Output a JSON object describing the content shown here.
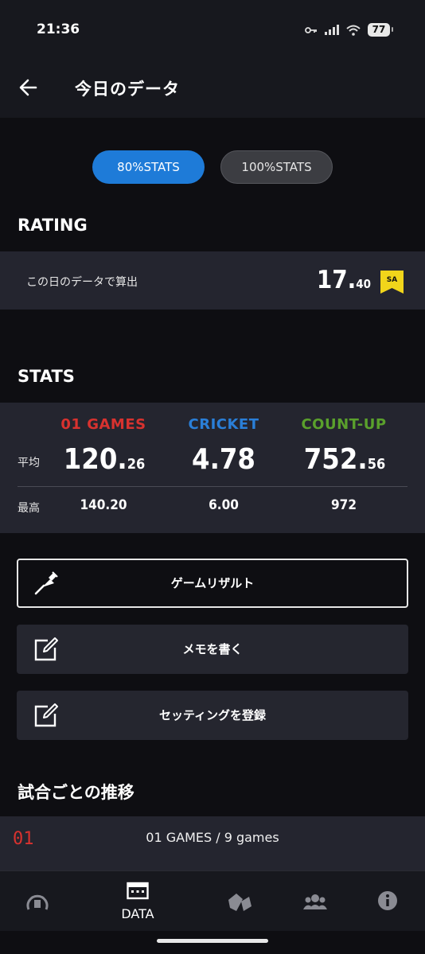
{
  "status_bar": {
    "time": "21:36",
    "battery": "77"
  },
  "header": {
    "title": "今日のデータ"
  },
  "toggle": {
    "option_80": "80%STATS",
    "option_100": "100%STATS",
    "selected": "80%STATS"
  },
  "rating": {
    "section_title": "RATING",
    "row_label": "この日のデータで算出",
    "value_int": "17.",
    "value_dec": "40",
    "badge": "SA"
  },
  "stats": {
    "section_title": "STATS",
    "avg_label": "平均",
    "max_label": "最高",
    "columns": [
      {
        "name": "01 GAMES",
        "color": "#d8322f",
        "avg_int": "120.",
        "avg_dec": "26",
        "max": "140.20"
      },
      {
        "name": "CRICKET",
        "color": "#2a7fd8",
        "avg_int": "4.78",
        "avg_dec": "",
        "max": "6.00"
      },
      {
        "name": "COUNT-UP",
        "color": "#5aa02c",
        "avg_int": "752.",
        "avg_dec": "56",
        "max": "972"
      }
    ]
  },
  "actions": {
    "game_result": "ゲームリザルト",
    "write_memo": "メモを書く",
    "register_setting": "セッティングを登録"
  },
  "transitions": {
    "section_title": "試合ごとの推移",
    "code": "01",
    "label": "01 GAMES / 9 games"
  },
  "bottom_nav": {
    "items": [
      {
        "icon": "home-icon",
        "label": ""
      },
      {
        "icon": "calendar-icon",
        "label": "DATA",
        "active": true
      },
      {
        "icon": "dartboard-icon",
        "label": ""
      },
      {
        "icon": "friends-icon",
        "label": ""
      },
      {
        "icon": "info-icon",
        "label": ""
      }
    ]
  }
}
